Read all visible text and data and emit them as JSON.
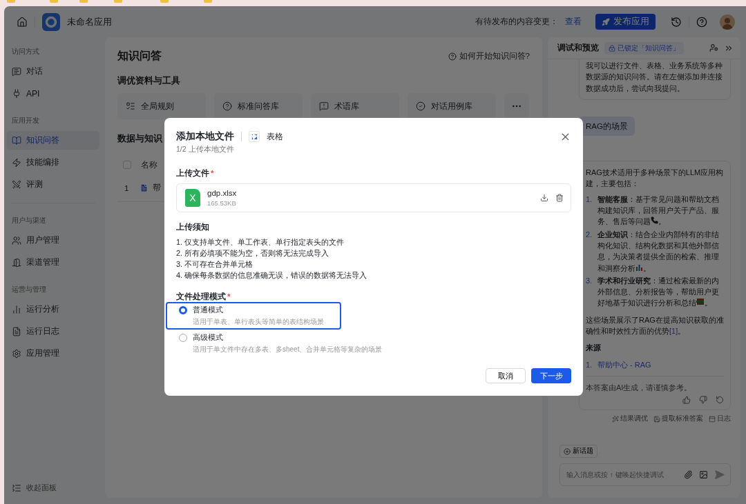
{
  "header": {
    "app_name": "未命名应用",
    "pending_label": "有待发布的内容变更：",
    "pending_link": "查看",
    "publish_button": "发布应用"
  },
  "sidebar": {
    "sections": [
      {
        "title": "访问方式",
        "items": [
          {
            "label": "对话",
            "selected": false
          },
          {
            "label": "API",
            "selected": false
          }
        ]
      },
      {
        "title": "应用开发",
        "items": [
          {
            "label": "知识问答",
            "selected": true
          },
          {
            "label": "技能编排",
            "selected": false
          },
          {
            "label": "评测",
            "selected": false
          }
        ]
      },
      {
        "title": "用户与渠道",
        "items": [
          {
            "label": "用户管理",
            "selected": false
          },
          {
            "label": "渠道管理",
            "selected": false
          }
        ]
      },
      {
        "title": "运营与管理",
        "items": [
          {
            "label": "运行分析",
            "selected": false
          },
          {
            "label": "运行日志",
            "selected": false
          },
          {
            "label": "应用管理",
            "selected": false
          }
        ]
      }
    ],
    "collapse": "收起面板"
  },
  "main": {
    "title": "知识问答",
    "help_link": "如何开始知识问答?",
    "tools_title": "调优资料与工具",
    "tools": [
      "全局规则",
      "标准问答库",
      "术语库",
      "对话用例库"
    ],
    "data_title": "数据与知识",
    "table": {
      "select_all_checked": false,
      "columns": [
        "名称"
      ],
      "rows": [
        {
          "index": "1",
          "name": "帮"
        }
      ]
    }
  },
  "preview": {
    "title": "调试和预览",
    "lock_badge": "已锁定「知识问答」",
    "greeting": "我可以进行文件、表格、业务系统等多种数据源的知识问答。请在左侧添加并连接数据成功后，尝试向我提问。",
    "question": "RAG的场景",
    "answer": {
      "intro": "RAG技术适用于多种场景下的LLM应用构建，主要包括：",
      "items": [
        {
          "number": "1.",
          "text": "**智能客服**：基于常见问题和帮助文档构建知识库，回答用户关于产品、服务、售后等问题",
          "tail": "。"
        },
        {
          "number": "2.",
          "text": "**企业知识**：结合企业内部特有的非结构化知识、结构化数据和其他外部信息，为决策者提供全面的检索、推理和洞察分析",
          "tail": "。"
        },
        {
          "number": "3.",
          "text": "**学术和行业研究**：通过检索最新的内外部信息、分析报告等，帮助用户更好地基于知识进行分析和总结",
          "tail": "。"
        }
      ],
      "summary": "这些场景展示了RAG在提高知识获取的准确性和时效性方面的优势",
      "citation": "[1]",
      "summary_tail": "。",
      "sources_title": "来源",
      "sources": [
        {
          "number": "1.",
          "label": "帮助中心 - RAG"
        }
      ],
      "disclaimer": "本答案由AI生成，请谨慎参考。"
    },
    "actions": [
      "结果调优",
      "提取标准答案",
      "日志"
    ],
    "new_topic": "新话题",
    "input": {
      "placeholder": "输入消息或按 ↑ 键唤起快捷调试"
    }
  },
  "modal": {
    "title": "添加本地文件",
    "type_label": "表格",
    "subtitle": "1/2 上传本地文件",
    "upload_label": {
      "label": "上传文件",
      "mark": "*"
    },
    "file": {
      "name": "gdp.xlsx",
      "size": "165.53KB",
      "badge": "X"
    },
    "notice_title": "上传须知",
    "notices": [
      "1. 仅支持单文件、单工作表、单行指定表头的文件",
      "2. 所有必填项不能为空，否则将无法完成导入",
      "3. 不可存在合并单元格",
      "4. 确保每条数据的信息准确无误，错误的数据将无法导入"
    ],
    "mode_label": {
      "label": "文件处理模式",
      "mark": "*"
    },
    "modes": [
      {
        "title": "普通模式",
        "desc": "适用于单表、单行表头等简单的表结构场景",
        "selected": true
      },
      {
        "title": "高级模式",
        "desc": "适用于单文件中存在多表、多sheet、合并单元格等复杂的场景",
        "selected": false
      }
    ],
    "cancel": "取消",
    "next": "下一步"
  }
}
